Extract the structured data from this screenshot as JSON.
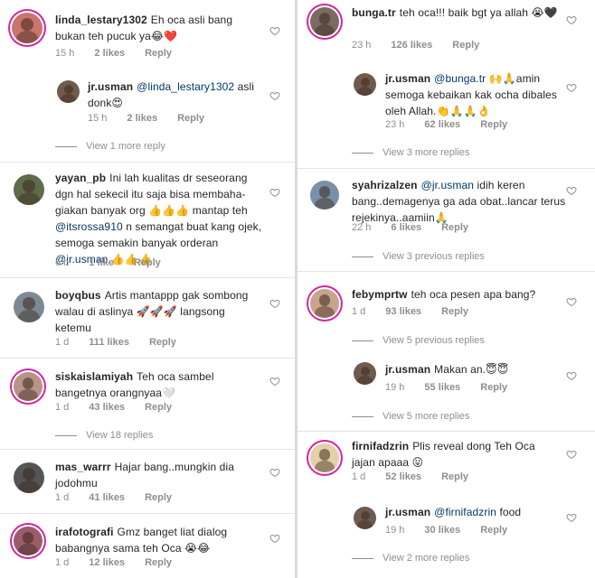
{
  "left": {
    "c1": {
      "user": "linda_lestary1302",
      "text": "Eh oca asli bang bukan teh pucuk ya😂❤️",
      "time": "15 h",
      "likes": "2 likes",
      "reply": "Reply"
    },
    "c1r": {
      "user": "jr.usman",
      "mention": "@linda_lestary1302",
      "text": "asli donk😍",
      "time": "15 h",
      "likes": "2 likes",
      "reply": "Reply"
    },
    "c1v": {
      "label": "View 1 more reply"
    },
    "c2": {
      "user": "yayan_pb",
      "text1": "Ini lah kualitas dr seseorang dgn hal sekecil itu saja bisa membaha-giakan banyak org 👍👍👍 mantap teh",
      "mention1": "@itsrossa910",
      "text2": "n semangat buat kang ojek, semoga semakin banyak orderan",
      "mention2": "@jr.usman",
      "text3": "👍👍👍",
      "time": "6 h",
      "likes": "1 like",
      "reply": "Reply"
    },
    "c3": {
      "user": "boyqbus",
      "text": "Artis mantappp gak sombong walau di aslinya 🚀🚀🚀 langsong ketemu",
      "time": "1 d",
      "likes": "111 likes",
      "reply": "Reply"
    },
    "c4": {
      "user": "siskaislamiyah",
      "text": "Teh oca sambel bangetnya orangnyaa🤍",
      "time": "1 d",
      "likes": "43 likes",
      "reply": "Reply"
    },
    "c4v": {
      "label": "View 18 replies"
    },
    "c5": {
      "user": "mas_warrr",
      "text": "Hajar bang..mungkin dia jodohmu",
      "time": "1 d",
      "likes": "41 likes",
      "reply": "Reply"
    },
    "c6": {
      "user": "irafotografi",
      "text": "Gmz banget liat dialog babangnya sama teh Oca 😭😂",
      "time": "1 d",
      "likes": "12 likes",
      "reply": "Reply"
    }
  },
  "right": {
    "c1": {
      "user": "bunga.tr",
      "text": "teh oca!!! baik bgt ya allah 😭🖤",
      "time": "23 h",
      "likes": "126 likes",
      "reply": "Reply"
    },
    "c1r": {
      "user": "jr.usman",
      "mention": "@bunga.tr",
      "text": "🙌🙏amin semoga kebaikan kak ocha dibales oleh Allah.👏🙏🙏👌",
      "time": "23 h",
      "likes": "62 likes",
      "reply": "Reply"
    },
    "c1v": {
      "label": "View 3 more replies"
    },
    "c2": {
      "user": "syahrizalzen",
      "mention": "@jr.usman",
      "text": "idih keren bang..demagenya ga ada obat..lancar terus rejekinya..aamiin🙏",
      "time": "22 h",
      "likes": "6 likes",
      "reply": "Reply"
    },
    "c2v": {
      "label": "View 3 previous replies"
    },
    "c3": {
      "user": "febymprtw",
      "text": "teh oca pesen apa bang?",
      "time": "1 d",
      "likes": "93 likes",
      "reply": "Reply"
    },
    "c3v": {
      "label": "View 5 previous replies"
    },
    "c3r": {
      "user": "jr.usman",
      "text": "Makan an.😇😇",
      "time": "19 h",
      "likes": "55 likes",
      "reply": "Reply"
    },
    "c3v2": {
      "label": "View 5 more replies"
    },
    "c4": {
      "user": "firnifadzrin",
      "text": "Plis reveal dong Teh Oca jajan apaaa 😛",
      "time": "1 d",
      "likes": "52 likes",
      "reply": "Reply"
    },
    "c4r": {
      "user": "jr.usman",
      "mention": "@firnifadzrin",
      "text": "food",
      "time": "19 h",
      "likes": "30 likes",
      "reply": "Reply"
    },
    "c4v": {
      "label": "View 2 more replies"
    }
  },
  "colors": {
    "text": "#262626",
    "meta": "#8e8e8e",
    "mention": "#00376b",
    "story_ring": "#d6249f",
    "divider": "#dadada"
  },
  "icons": {
    "like": "heart-outline-icon"
  }
}
